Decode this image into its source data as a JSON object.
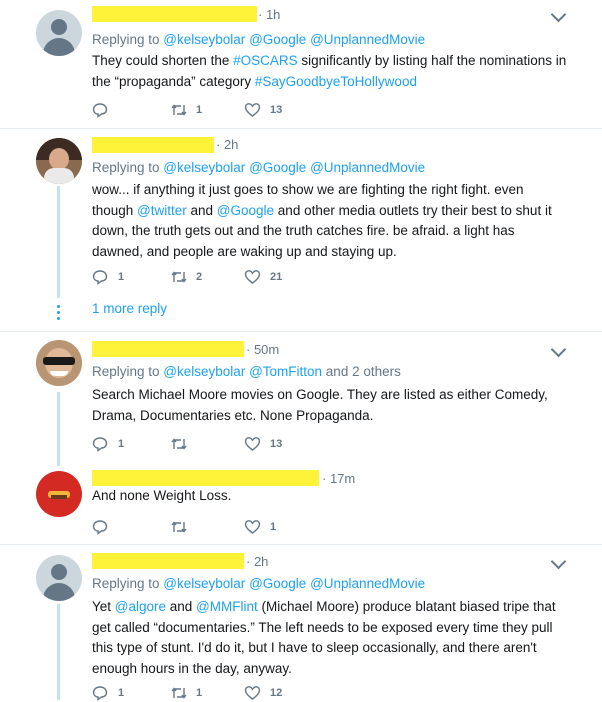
{
  "tweets": [
    {
      "time": "· 1h",
      "replying_label": "Replying to ",
      "mentions": [
        "@kelseybolar",
        "@Google",
        "@UnplannedMovie"
      ],
      "text_parts": [
        "They could shorten the ",
        "#OSCARS",
        " significantly by listing half the nominations in the “propaganda” category ",
        "#SayGoodbyeToHollywood"
      ],
      "reply_count": "",
      "retweet_count": "1",
      "like_count": "13"
    },
    {
      "time": "· 2h",
      "replying_label": "Replying to ",
      "mentions": [
        "@kelseybolar",
        "@Google",
        "@UnplannedMovie"
      ],
      "text_line1": "wow... if anything it just goes to show we are fighting the right fight. even",
      "text_l2_a": "though ",
      "text_l2_link1": "@twitter",
      "text_l2_b": " and ",
      "text_l2_link2": "@Google",
      "text_l2_c": " and other media outlets try their best to shut it",
      "text_line3": "down, the truth gets out and the truth catches fire. be afraid. a light has",
      "text_line4": "dawned, and people are waking up and staying up.",
      "reply_count": "1",
      "retweet_count": "2",
      "like_count": "21",
      "more_reply": "1 more reply"
    },
    {
      "time": "· 50m",
      "replying_label": "Replying to ",
      "mentions": [
        "@kelseybolar",
        "@TomFitton"
      ],
      "mentions_suffix": " and 2 others",
      "text_line1": "Search Michael Moore movies on Google. They are listed as either Comedy,",
      "text_line2": "Drama, Documentaries etc. None Propaganda.",
      "reply_count": "1",
      "retweet_count": "",
      "like_count": "13"
    },
    {
      "time": "· 17m",
      "text": "And none Weight Loss.",
      "reply_count": "",
      "retweet_count": "",
      "like_count": "1"
    },
    {
      "time": "· 2h",
      "replying_label": "Replying to ",
      "mentions": [
        "@kelseybolar",
        "@Google",
        "@UnplannedMovie"
      ],
      "text_l1_a": "Yet ",
      "text_l1_link1": "@algore",
      "text_l1_b": " and ",
      "text_l1_link2": "@MMFlint",
      "text_l1_c": " (Michael Moore) produce blatant biased tripe that",
      "text_line2": "get called “documentaries.” The left needs to be exposed every time they pull",
      "text_line3": "this type of stunt. I'd do it, but I have to sleep occasionally, and there aren't",
      "text_line4": "enough hours in the day, anyway.",
      "reply_count": "1",
      "retweet_count": "1",
      "like_count": "12"
    }
  ],
  "colors": {
    "accent": "#1da1f2",
    "muted": "#657786",
    "redaction": "#fff33a",
    "thread": "#c4e2f7"
  }
}
